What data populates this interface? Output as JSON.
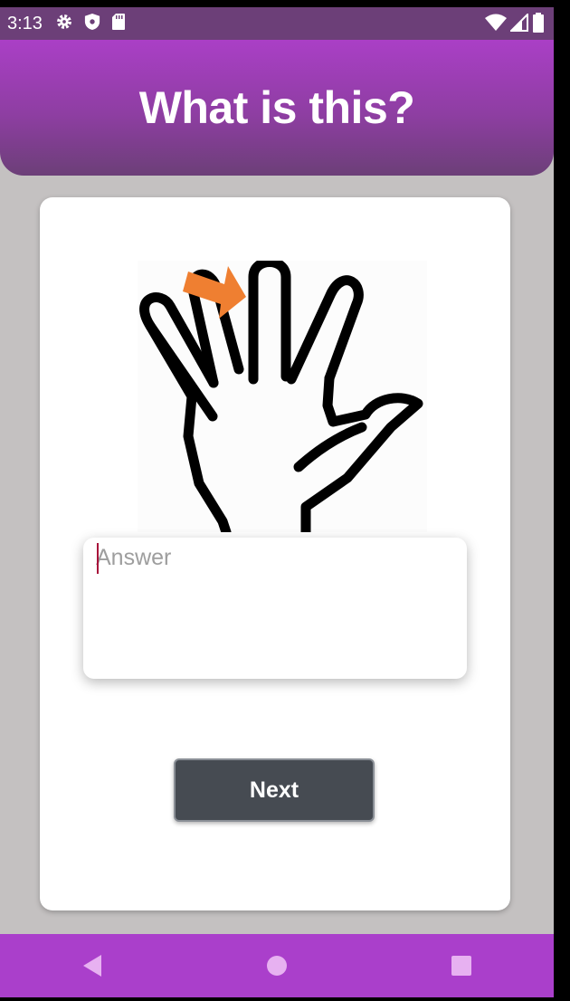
{
  "status_bar": {
    "time": "3:13",
    "left_icons": [
      "gear-icon",
      "shield-icon",
      "sd-card-icon"
    ],
    "right_icons": [
      "wifi-icon",
      "signal-icon",
      "battery-icon"
    ]
  },
  "header": {
    "title": "What is this?",
    "gradient_top": "#aa3fc6",
    "gradient_bottom": "#6c3f78"
  },
  "quiz": {
    "image": "hand-pointing-middle-finger-image",
    "arrow_color": "#ef7f31"
  },
  "answer": {
    "value": "",
    "placeholder": "Answer"
  },
  "next_button": {
    "label": "Next",
    "color": "#464b52"
  },
  "nav_bar": {
    "buttons": [
      "back-icon",
      "home-icon",
      "recents-icon"
    ],
    "color": "#aa3fcb"
  }
}
